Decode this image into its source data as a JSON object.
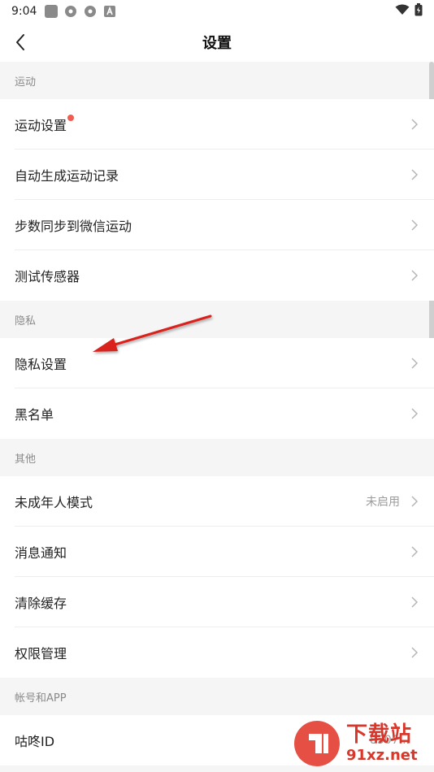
{
  "status_bar": {
    "time": "9:04"
  },
  "header": {
    "title": "设置"
  },
  "sections": [
    {
      "title": "运动",
      "items": [
        {
          "label": "运动设置",
          "badge": true
        },
        {
          "label": "自动生成运动记录"
        },
        {
          "label": "步数同步到微信运动"
        },
        {
          "label": "测试传感器"
        }
      ]
    },
    {
      "title": "隐私",
      "items": [
        {
          "label": "隐私设置"
        },
        {
          "label": "黑名单"
        }
      ]
    },
    {
      "title": "其他",
      "items": [
        {
          "label": "未成年人模式",
          "value": "未启用"
        },
        {
          "label": "消息通知"
        },
        {
          "label": "清除缓存"
        },
        {
          "label": "权限管理"
        }
      ]
    },
    {
      "title": "帐号和APP",
      "items": [
        {
          "label": "咕咚ID",
          "value": "8307..."
        }
      ]
    }
  ],
  "watermark": {
    "top": "下载站",
    "bottom": "91xz.net"
  },
  "colors": {
    "badge": "#f25b4f",
    "annotation_arrow": "#d9231c"
  }
}
